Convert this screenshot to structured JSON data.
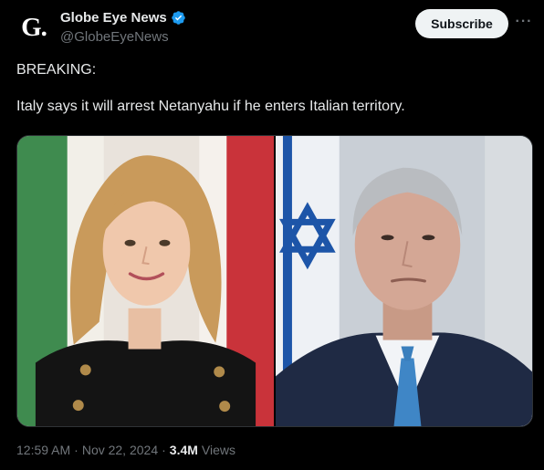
{
  "account": {
    "avatar_letter": "G.",
    "display_name": "Globe Eye News",
    "handle": "@GlobeEyeNews",
    "verified": true
  },
  "actions": {
    "subscribe_label": "Subscribe",
    "more_label": "···"
  },
  "tweet": {
    "line1": "BREAKING:",
    "line2": "Italy says it will arrest Netanyahu if he enters Italian territory."
  },
  "media": {
    "images": [
      {
        "icon": "woman-portrait-italian-flag-photo"
      },
      {
        "icon": "man-portrait-israeli-flag-photo"
      }
    ]
  },
  "meta": {
    "time": "12:59 AM",
    "separator": "·",
    "date": "Nov 22, 2024",
    "views_count": "3.4M",
    "views_label": "Views"
  },
  "colors": {
    "background": "#000000",
    "text": "#e7e9ea",
    "secondary": "#71767b",
    "verified": "#1d9bf0",
    "button_bg": "#eff3f4"
  }
}
